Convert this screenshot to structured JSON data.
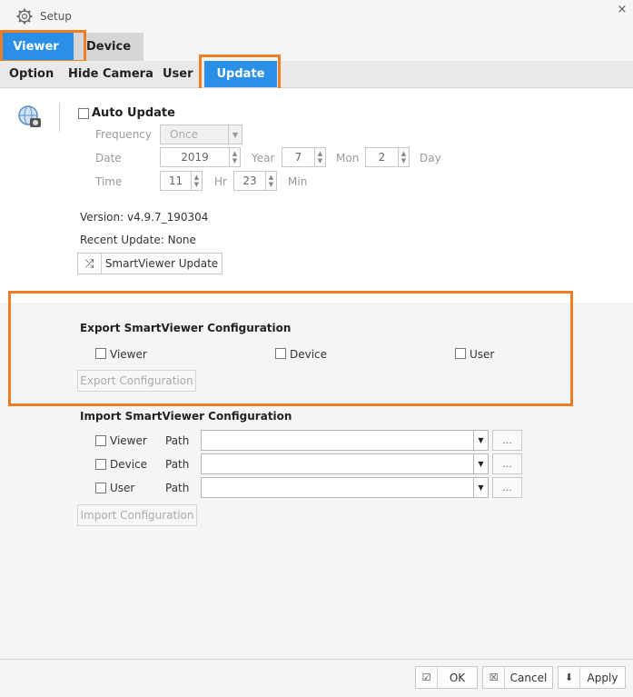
{
  "window": {
    "title": "Setup",
    "close_glyph": "×"
  },
  "tabs": {
    "viewer": "Viewer",
    "device": "Device"
  },
  "subtabs": {
    "option": "Option",
    "hide_camera": "Hide Camera",
    "user": "User",
    "update": "Update"
  },
  "auto_update": {
    "label": "Auto Update",
    "frequency_label": "Frequency",
    "frequency_value": "Once",
    "date_label": "Date",
    "year_value": "2019",
    "year_unit": "Year",
    "month_value": "7",
    "month_unit": "Mon",
    "day_value": "2",
    "day_unit": "Day",
    "time_label": "Time",
    "hour_value": "11",
    "hour_unit": "Hr",
    "minute_value": "23",
    "minute_unit": "Min"
  },
  "version": {
    "text": "Version: v4.9.7_190304",
    "recent": "Recent Update: None"
  },
  "smartviewer_update_button": "SmartViewer Update",
  "export": {
    "title": "Export SmartViewer Configuration",
    "viewer": "Viewer",
    "device": "Device",
    "user": "User",
    "button": "Export Configuration"
  },
  "import": {
    "title": "Import SmartViewer Configuration",
    "rows": [
      {
        "label": "Viewer",
        "path_label": "Path",
        "path_value": ""
      },
      {
        "label": "Device",
        "path_label": "Path",
        "path_value": ""
      },
      {
        "label": "User",
        "path_label": "Path",
        "path_value": ""
      }
    ],
    "browse": "...",
    "button": "Import Configuration"
  },
  "footer": {
    "ok": "OK",
    "cancel": "Cancel",
    "apply": "Apply"
  },
  "colors": {
    "accent": "#2a8fe6",
    "highlight": "#f07f23"
  }
}
